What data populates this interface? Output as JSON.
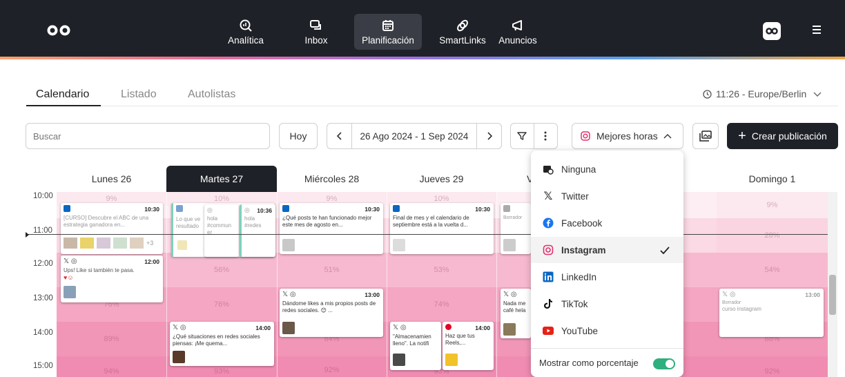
{
  "nav": {
    "items": [
      {
        "label": "Analítica",
        "icon": "analytics-icon"
      },
      {
        "label": "Inbox",
        "icon": "inbox-icon"
      },
      {
        "label": "Planificación",
        "icon": "calendar-icon",
        "active": true
      },
      {
        "label": "SmartLinks",
        "icon": "link-icon"
      },
      {
        "label": "Anuncios",
        "icon": "megaphone-icon"
      }
    ]
  },
  "tabs": [
    "Calendario",
    "Listado",
    "Autolistas"
  ],
  "timezone": "11:26 - Europe/Berlin",
  "toolbar": {
    "search_placeholder": "Buscar",
    "today": "Hoy",
    "date_range": "26 Ago 2024 - 1 Sep 2024",
    "best_hours": "Mejores horas",
    "create": "Crear publicación"
  },
  "days": [
    "Lunes 26",
    "Martes 27",
    "Miércoles 28",
    "Jueves 29",
    "V",
    "Domingo 1"
  ],
  "hours": [
    "10:00",
    "11:00",
    "12:00",
    "13:00",
    "14:00",
    "15:00"
  ],
  "percents": {
    "r1": [
      "9%",
      "10%",
      "9%",
      "10%",
      "9%"
    ],
    "r2": [
      "28%"
    ],
    "r3": [
      "56%",
      "51%",
      "53%",
      "54%"
    ],
    "r4": [
      "76%",
      "76%",
      "74%"
    ],
    "r5": [
      "89%",
      "84%",
      "88%"
    ],
    "r6": [
      "94%",
      "93%",
      "92%",
      "93%",
      "92%"
    ]
  },
  "cards": {
    "c1": {
      "time": "10:30",
      "text": "[CURSO] Descubre el ABC de una estrategia ganadora en...",
      "more": "+3"
    },
    "c2": {
      "time": "12:00",
      "text": "Ups! Like si también te pasa."
    },
    "c3a": {
      "text": "Lo que ve resultado"
    },
    "c3b": {
      "text": "hola #commun er"
    },
    "c3c": {
      "time": "10:36",
      "text": "hola #redes"
    },
    "c4": {
      "time": "10:30",
      "text": "¿Qué posts te han funcionado mejor este mes de agosto en..."
    },
    "c5": {
      "time": "10:30",
      "text": "Final de mes y el calendario de septiembre está a la vuelta d..."
    },
    "c6": {
      "label": "Borrador"
    },
    "c7": {
      "time": "13:00",
      "text": "Dándome likes a mis propios posts de redes sociales. 😊 ..."
    },
    "c8": {
      "time": "14:00",
      "text": "¿Qué situaciones en redes sociales piensas: ¡Me quema..."
    },
    "c9": {
      "text": "\"Almacenamien lleno\". La notifi"
    },
    "c10": {
      "time": "14:00",
      "text": "Haz que tus Reels,..."
    },
    "c11": {
      "text": "Nada me café hela"
    },
    "c12": {
      "time": "13:00",
      "label": "Borrador",
      "text": "curso instagram"
    }
  },
  "dropdown": {
    "items": [
      {
        "label": "Ninguna",
        "icon": "calendar-clock-icon"
      },
      {
        "label": "Twitter",
        "icon": "x-icon"
      },
      {
        "label": "Facebook",
        "icon": "facebook-icon"
      },
      {
        "label": "Instagram",
        "icon": "instagram-icon",
        "selected": true
      },
      {
        "label": "LinkedIn",
        "icon": "linkedin-icon"
      },
      {
        "label": "TikTok",
        "icon": "tiktok-icon"
      },
      {
        "label": "YouTube",
        "icon": "youtube-icon"
      }
    ],
    "footer": "Mostrar como porcentaje"
  },
  "colors": {
    "dark": "#1f2128",
    "linkedin": "#0a66c2",
    "instagram": "#e1306c",
    "facebook": "#1877f2",
    "youtube": "#e62117",
    "toggle": "#2fae7e"
  }
}
